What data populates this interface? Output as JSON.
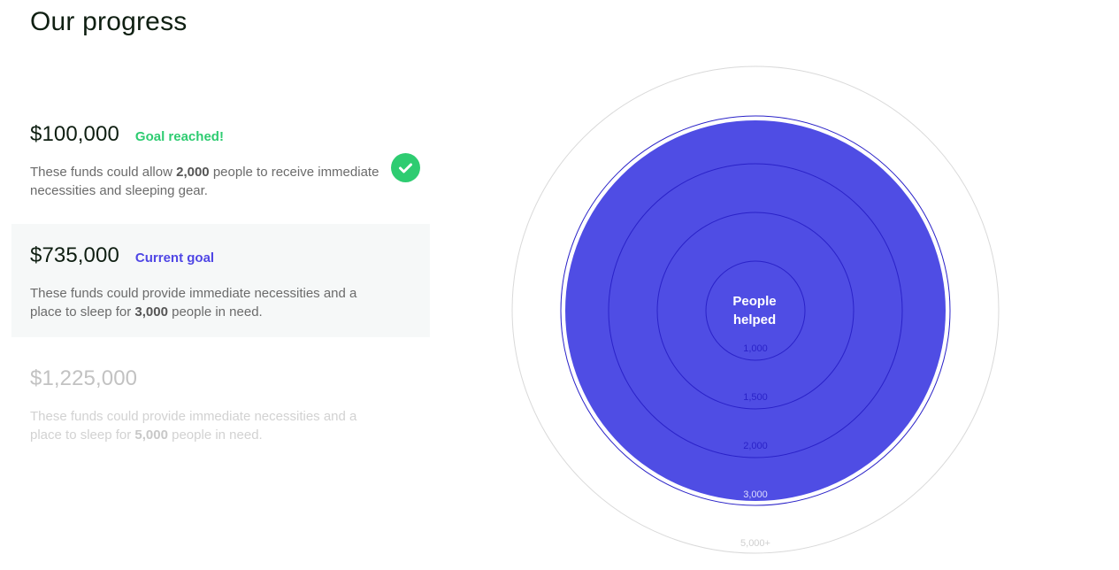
{
  "page_title": "Our progress",
  "milestones": [
    {
      "amount": "$100,000",
      "status": "Goal reached!",
      "desc_pre": "These funds could allow ",
      "desc_num": "2,000",
      "desc_post": " people to receive immediate necessities and sleeping gear."
    },
    {
      "amount": "$735,000",
      "status": "Current goal",
      "desc_pre": "These funds could provide immediate necessities and a place to sleep for ",
      "desc_num": "3,000",
      "desc_post": " people in need."
    },
    {
      "amount": "$1,225,000",
      "desc_pre": "These funds could provide immediate necessities and a place to sleep for ",
      "desc_num": "5,000",
      "desc_post": " people in need."
    }
  ],
  "chart": {
    "center_label": "People helped",
    "rings": [
      "1,000",
      "1,500",
      "2,000",
      "3,000",
      "5,000+"
    ],
    "filled_through": "3,000",
    "fill_color": "#4f4de4",
    "ring_line_color": "#2a22c8",
    "outer_ring_color": "#d9d9d9"
  },
  "colors": {
    "reached": "#2ecc71",
    "current": "#4f46e5"
  }
}
